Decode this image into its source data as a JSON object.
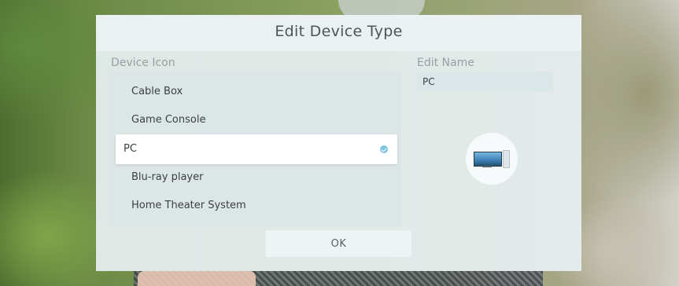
{
  "dialog": {
    "title": "Edit Device Type",
    "device_icon_label": "Device Icon",
    "edit_name_label": "Edit Name",
    "edit_name_value": "PC",
    "ok_label": "OK"
  },
  "device_list": {
    "items": [
      {
        "label": "Cable Box",
        "selected": false
      },
      {
        "label": "Game Console",
        "selected": false
      },
      {
        "label": "PC",
        "selected": true
      },
      {
        "label": "Blu-ray player",
        "selected": false
      },
      {
        "label": "Home Theater System",
        "selected": false
      }
    ]
  },
  "preview": {
    "icon": "pc-monitor-icon"
  },
  "colors": {
    "selection_check": "#7cc4df",
    "dialog_bg": "#e7eff1"
  }
}
